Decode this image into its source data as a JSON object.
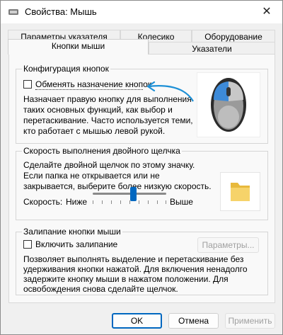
{
  "window": {
    "title": "Свойства: Мышь",
    "close_glyph": "✕"
  },
  "tabs": {
    "row1": [
      "Параметры указателя",
      "Колесико",
      "Оборудование"
    ],
    "row2": [
      "Кнопки мыши",
      "Указатели"
    ]
  },
  "button_config": {
    "legend": "Конфигурация кнопок",
    "swap_checkbox_label": "Обменять назначение кнопок",
    "swap_checked": false,
    "description": [
      "Назначает правую кнопку для выполнения",
      "таких основных функций, как выбор и",
      "перетаскивание. Часто используется теми,",
      "кто работает с мышью левой рукой."
    ]
  },
  "double_click": {
    "legend": "Скорость выполнения двойного щелчка",
    "description": [
      "Сделайте двойной щелчок по этому значку.",
      "Если папка не открывается или не",
      "закрывается, выберите более низкую скорость."
    ],
    "speed_label": "Скорость:",
    "slow_label": "Ниже",
    "fast_label": "Выше",
    "speed_value_fraction": 0.5
  },
  "click_lock": {
    "legend": "Залипание кнопки мыши",
    "enable_label": "Включить залипание",
    "enabled": false,
    "settings_button": "Параметры...",
    "description": [
      "Позволяет выполнять выделение и перетаскивание без",
      "удерживания кнопки нажатой. Для включения ненадолго",
      "задержите кнопку мыши в нажатом положении. Для",
      "освобождения снова сделайте щелчок."
    ]
  },
  "footer": {
    "ok": "OK",
    "cancel": "Отмена",
    "apply": "Применить"
  },
  "colors": {
    "accent": "#0067c0",
    "annotation_arrow": "#1e90d6"
  }
}
